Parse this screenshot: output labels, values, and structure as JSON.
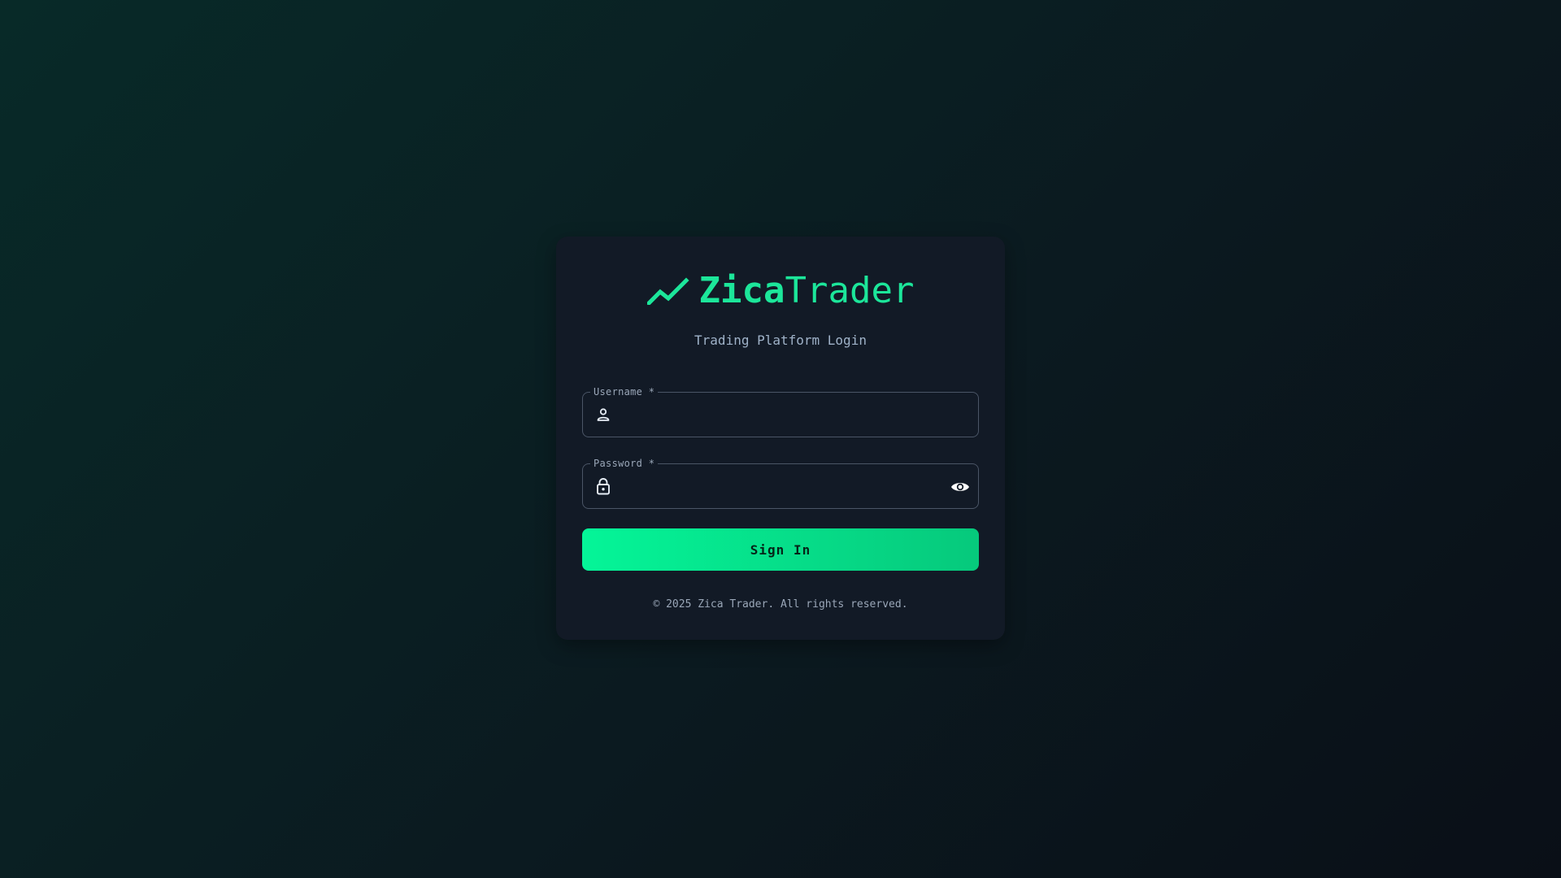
{
  "brand": {
    "name_bold": "Zica",
    "name_light": "Trader",
    "icon": "trending-up-icon",
    "accent_color": "#1ce69a"
  },
  "subtitle": "Trading Platform Login",
  "form": {
    "username": {
      "label": "Username *",
      "value": "",
      "icon": "user-icon"
    },
    "password": {
      "label": "Password *",
      "value": "",
      "icon": "lock-icon",
      "toggle_icon": "eye-icon"
    },
    "submit_label": "Sign In",
    "submit_color": "#05f598"
  },
  "footer": "© 2025 Zica Trader. All rights reserved."
}
